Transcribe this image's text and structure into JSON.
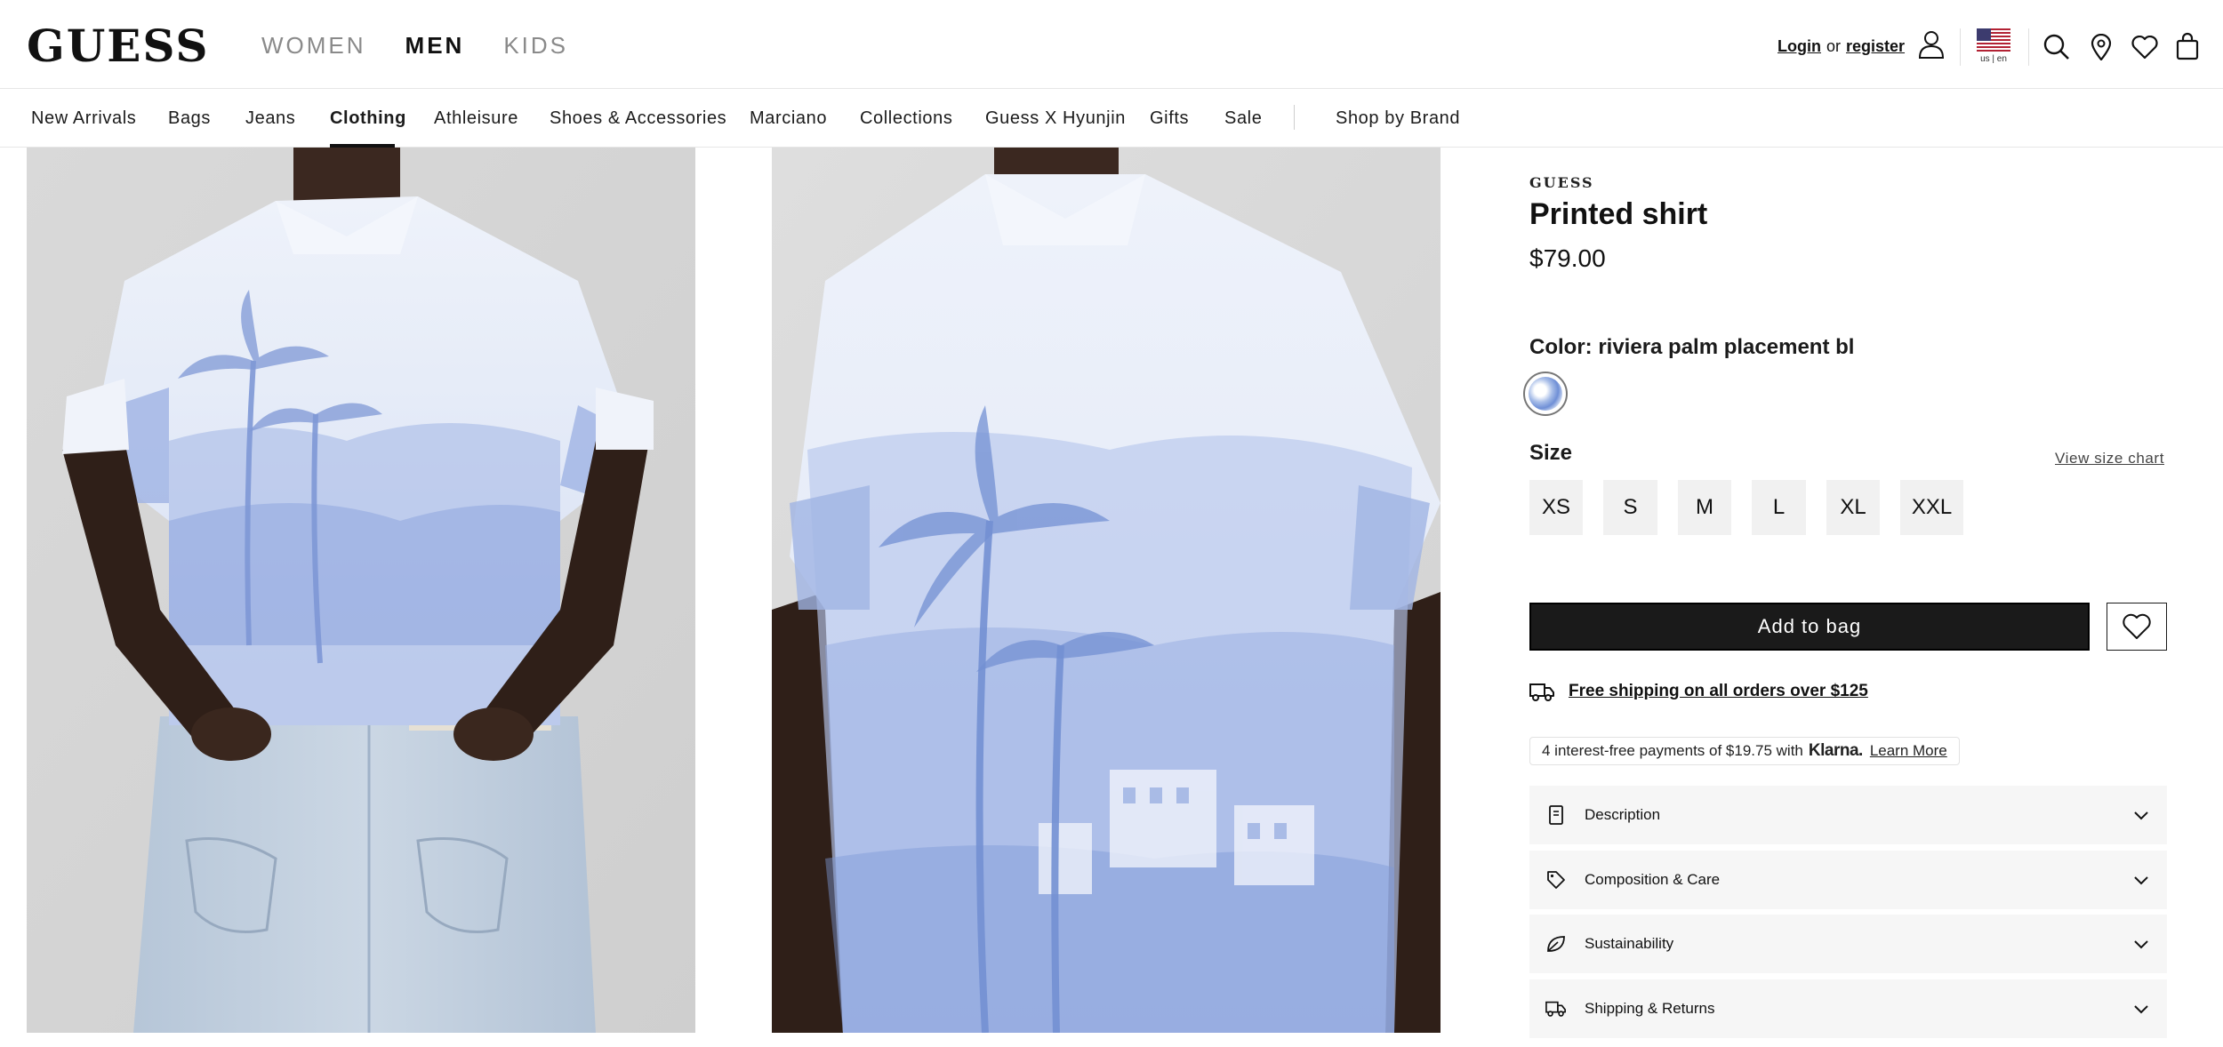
{
  "header": {
    "logo": "GUESS",
    "gender_tabs": [
      {
        "label": "WOMEN",
        "active": false
      },
      {
        "label": "MEN",
        "active": true
      },
      {
        "label": "KIDS",
        "active": false
      }
    ],
    "login_label": "Login",
    "or_label": "or",
    "register_label": "register",
    "locale_label": "us | en",
    "icons": [
      "account-icon",
      "us-flag-icon",
      "search-icon",
      "store-locator-icon",
      "wishlist-icon",
      "shopping-bag-icon"
    ]
  },
  "category_nav": {
    "items": [
      {
        "label": "New Arrivals"
      },
      {
        "label": "Bags"
      },
      {
        "label": "Jeans"
      },
      {
        "label": "Clothing",
        "active": true
      },
      {
        "label": "Athleisure"
      },
      {
        "label": "Shoes & Accessories"
      },
      {
        "label": "Marciano"
      },
      {
        "label": "Collections"
      },
      {
        "label": "Guess X Hyunjin"
      },
      {
        "label": "Gifts"
      },
      {
        "label": "Sale"
      }
    ],
    "shop_by_brand": "Shop by Brand"
  },
  "product": {
    "brand": "GUESS",
    "name": "Printed shirt",
    "price": "$79.00",
    "color_label": "Color: riviera palm placement bl",
    "size_label": "Size",
    "size_chart_link": "View size chart",
    "sizes": [
      "XS",
      "S",
      "M",
      "L",
      "XL",
      "XXL"
    ],
    "add_to_bag": "Add to bag",
    "shipping_text": "Free shipping on all orders over $125",
    "klarna": {
      "text": "4 interest-free payments of $19.75 with",
      "brand": "Klarna.",
      "learn_more": "Learn More"
    },
    "accordions": [
      {
        "label": "Description",
        "icon": "document-icon"
      },
      {
        "label": "Composition & Care",
        "icon": "tag-icon"
      },
      {
        "label": "Sustainability",
        "icon": "leaf-icon"
      },
      {
        "label": "Shipping & Returns",
        "icon": "truck-icon"
      }
    ]
  },
  "colors": {
    "accent": "#1a1a1a",
    "print_blue": "#7b97d8",
    "muted_nav": "#8a8a8a",
    "accordion_bg": "#f6f6f6"
  }
}
